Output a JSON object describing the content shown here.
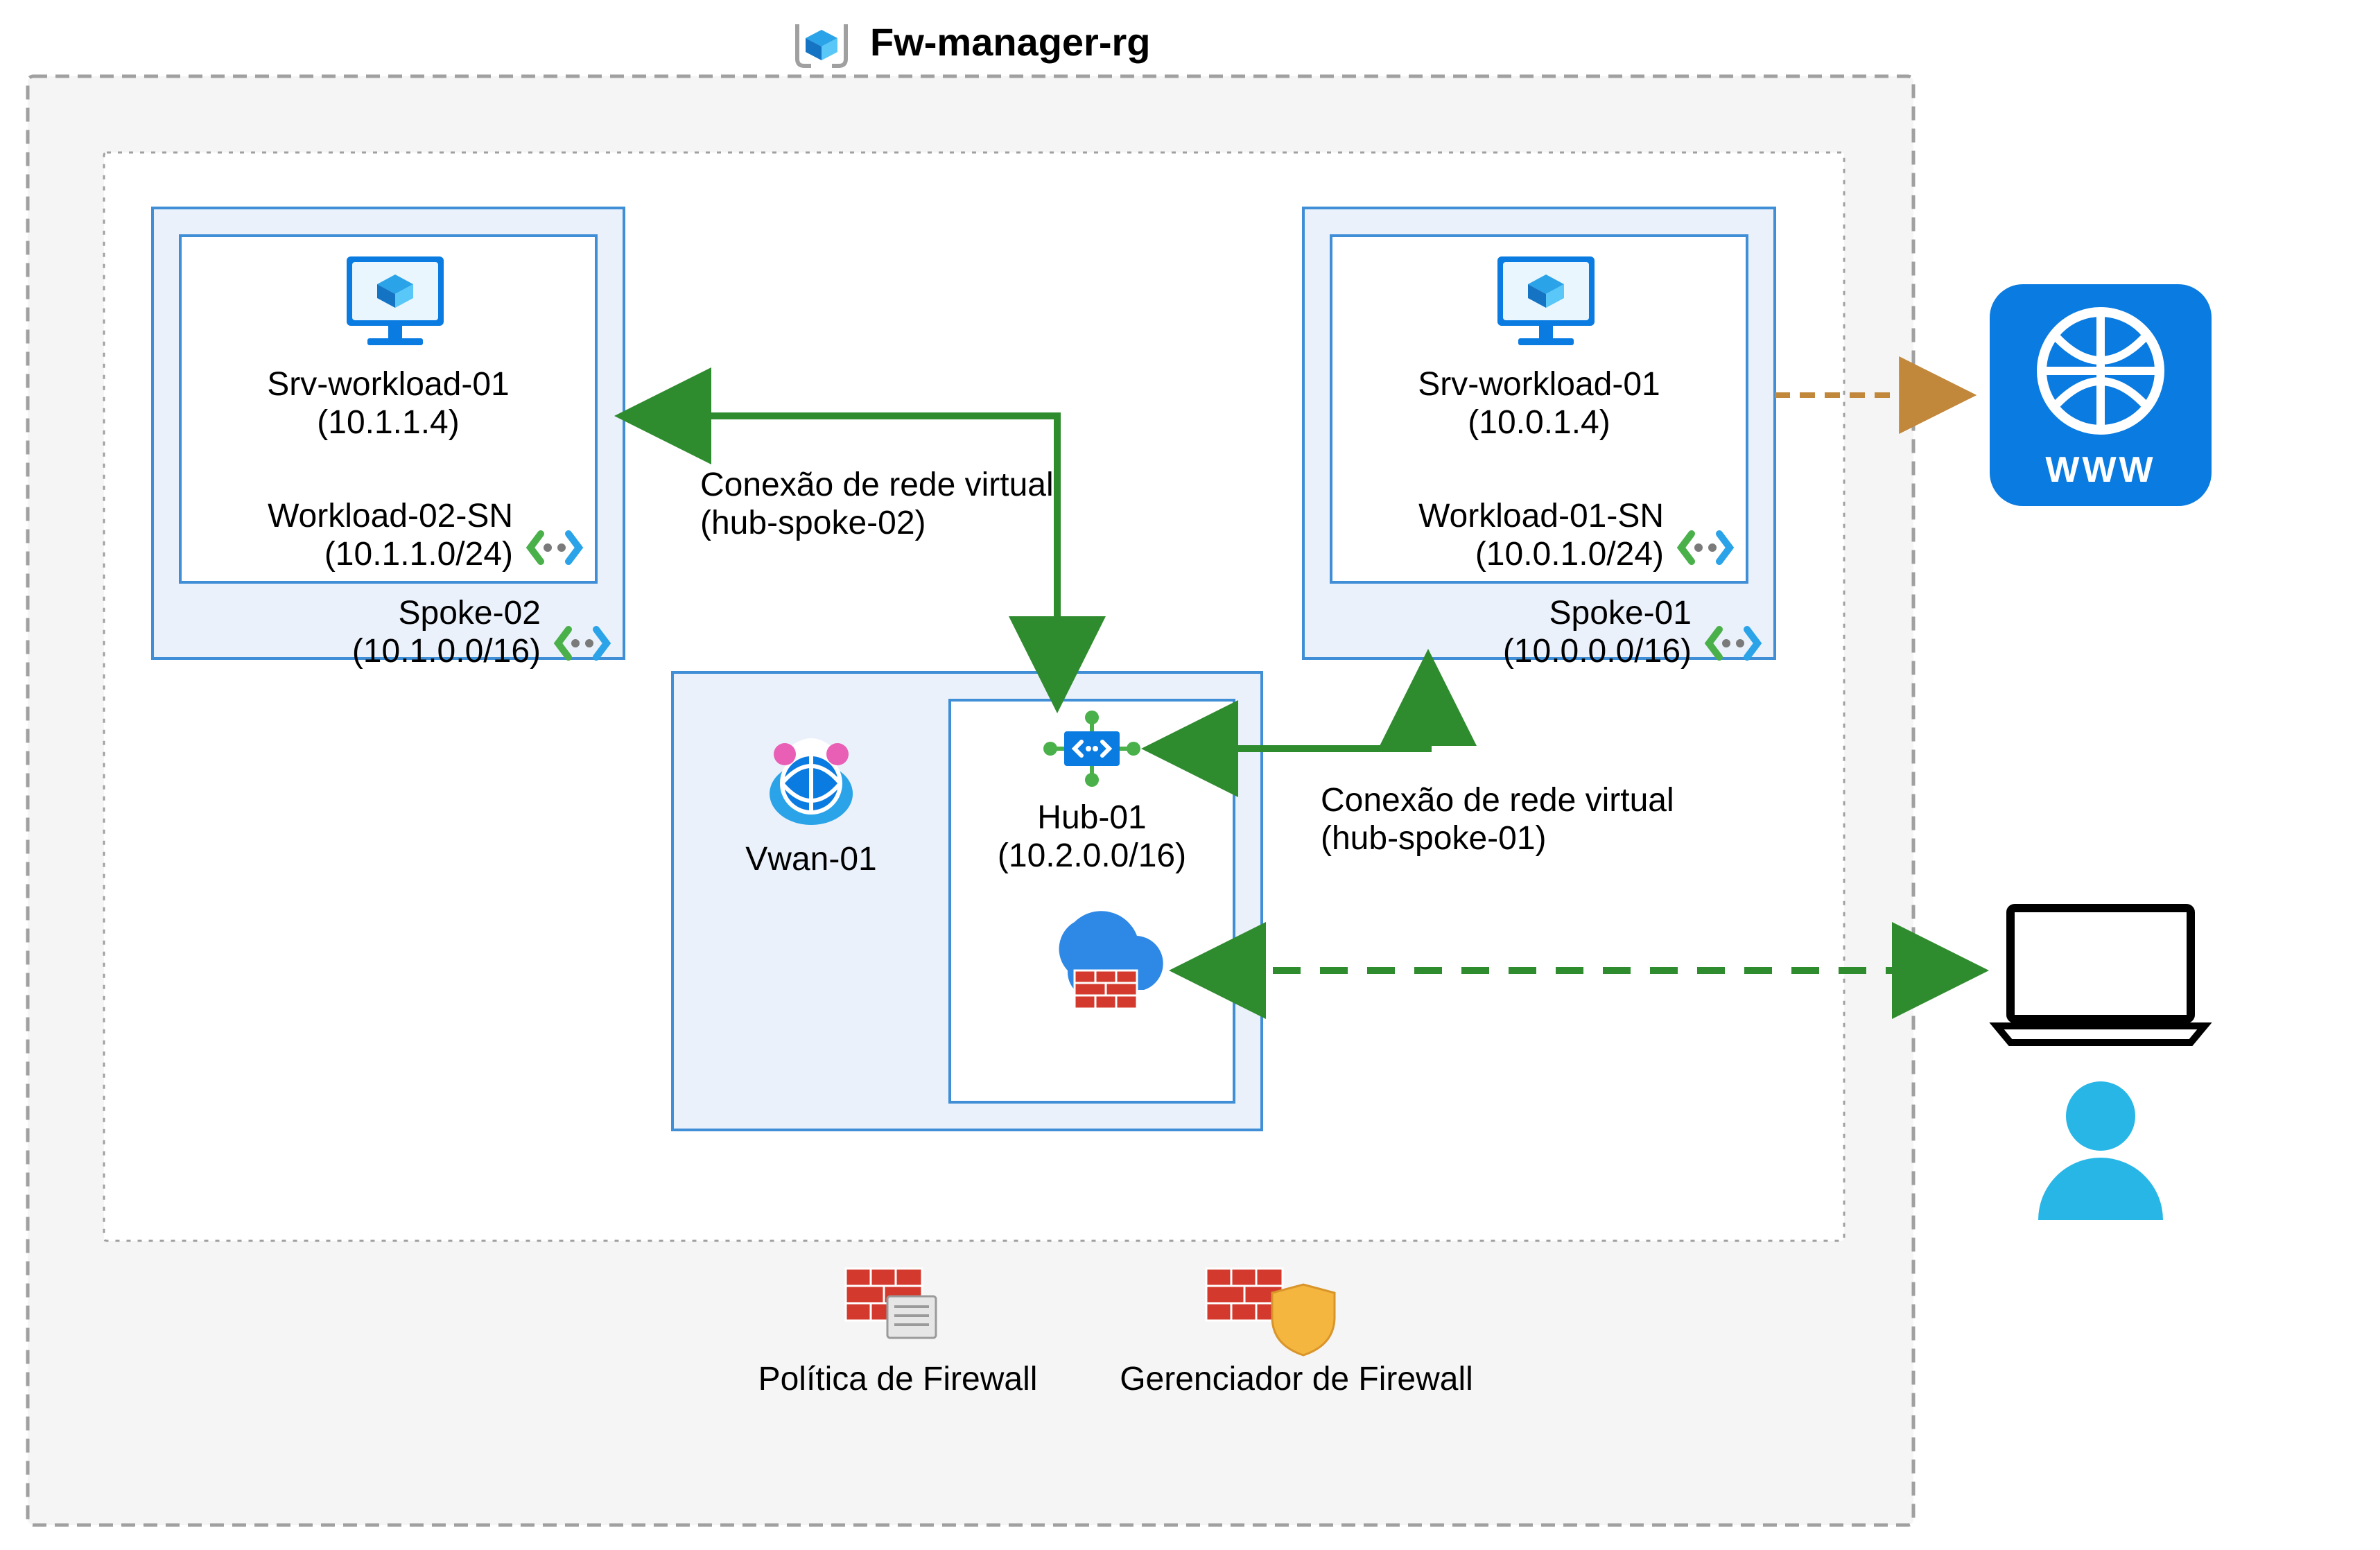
{
  "resource_group": {
    "title": "Fw-manager-rg"
  },
  "spoke2": {
    "vm_name": "Srv-workload-01",
    "vm_ip": "(10.1.1.4)",
    "subnet_name": "Workload-02-SN",
    "subnet_cidr": "(10.1.1.0/24)",
    "vnet_name": "Spoke-02",
    "vnet_cidr": "(10.1.0.0/16)"
  },
  "spoke1": {
    "vm_name": "Srv-workload-01",
    "vm_ip": "(10.0.1.4)",
    "subnet_name": "Workload-01-SN",
    "subnet_cidr": "(10.0.1.0/24)",
    "vnet_name": "Spoke-01",
    "vnet_cidr": "(10.0.0.0/16)"
  },
  "vwan": {
    "name": "Vwan-01"
  },
  "hub": {
    "name": "Hub-01",
    "cidr": "(10.2.0.0/16)"
  },
  "conn_left": {
    "line1": "Conexão de rede virtual",
    "line2": "(hub-spoke-02)"
  },
  "conn_right": {
    "line1": "Conexão de rede virtual",
    "line2": "(hub-spoke-01)"
  },
  "legend": {
    "policy": "Política de Firewall",
    "manager": "Gerenciador de Firewall"
  },
  "external": {
    "www_label": "WWW"
  }
}
